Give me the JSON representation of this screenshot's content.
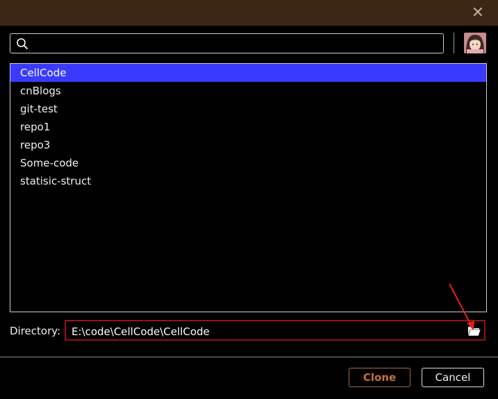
{
  "window": {
    "close_glyph": "✕"
  },
  "search": {
    "value": "",
    "placeholder": ""
  },
  "repos": [
    {
      "label": "CellCode",
      "selected": true
    },
    {
      "label": "cnBlogs",
      "selected": false
    },
    {
      "label": "git-test",
      "selected": false
    },
    {
      "label": "repo1",
      "selected": false
    },
    {
      "label": "repo3",
      "selected": false
    },
    {
      "label": "Some-code",
      "selected": false
    },
    {
      "label": "statisic-struct",
      "selected": false
    }
  ],
  "directory": {
    "label": "Directory:",
    "value": "E:\\code\\CellCode\\CellCode"
  },
  "buttons": {
    "clone": "Clone",
    "cancel": "Cancel"
  },
  "colors": {
    "titlebar": "#3b2713",
    "selection": "#3a3aff",
    "highlight_border": "#9b0f16",
    "clone_accent": "#c7703a"
  },
  "icons": [
    "close-icon",
    "search-icon",
    "avatar",
    "folder-open-icon"
  ]
}
